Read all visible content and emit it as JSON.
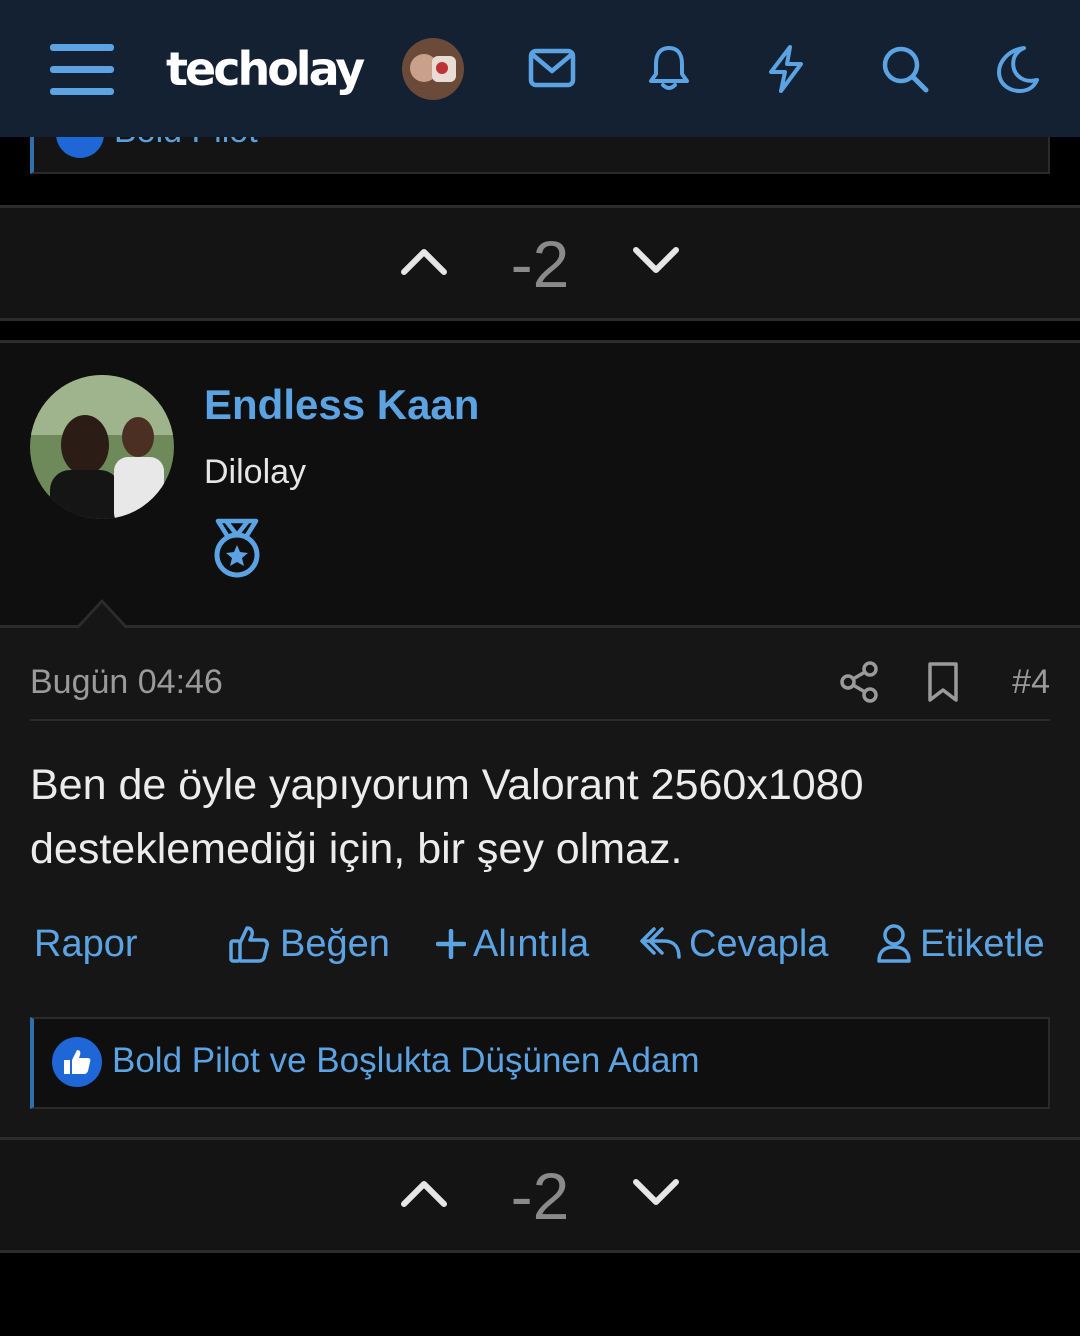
{
  "app": {
    "logo_text": "techolay"
  },
  "topbar": {
    "icons": [
      "menu-icon",
      "avatar",
      "mail-icon",
      "bell-icon",
      "lightning-icon",
      "search-icon",
      "moon-icon"
    ]
  },
  "previous_post": {
    "likes_text": "Bold Pilot",
    "vote_score": "-2"
  },
  "post": {
    "author": {
      "name": "Endless Kaan",
      "title": "Dilolay",
      "badge_icon": "medal-icon"
    },
    "date": "Bugün 04:46",
    "number": "#4",
    "content": "Ben de öyle yapıyorum Valorant 2560x1080 desteklemediği için, bir şey olmaz.",
    "actions": {
      "report": "Rapor",
      "like": "Beğen",
      "quote": "Alıntıla",
      "reply": "Cevapla",
      "tag": "Etiketle"
    },
    "likes_text": "Bold Pilot ve Boşlukta Düşünen Adam",
    "vote_score": "-2"
  },
  "colors": {
    "accent": "#5ba3e3",
    "nav_bg": "#142133",
    "like_badge": "#1f66d6"
  }
}
